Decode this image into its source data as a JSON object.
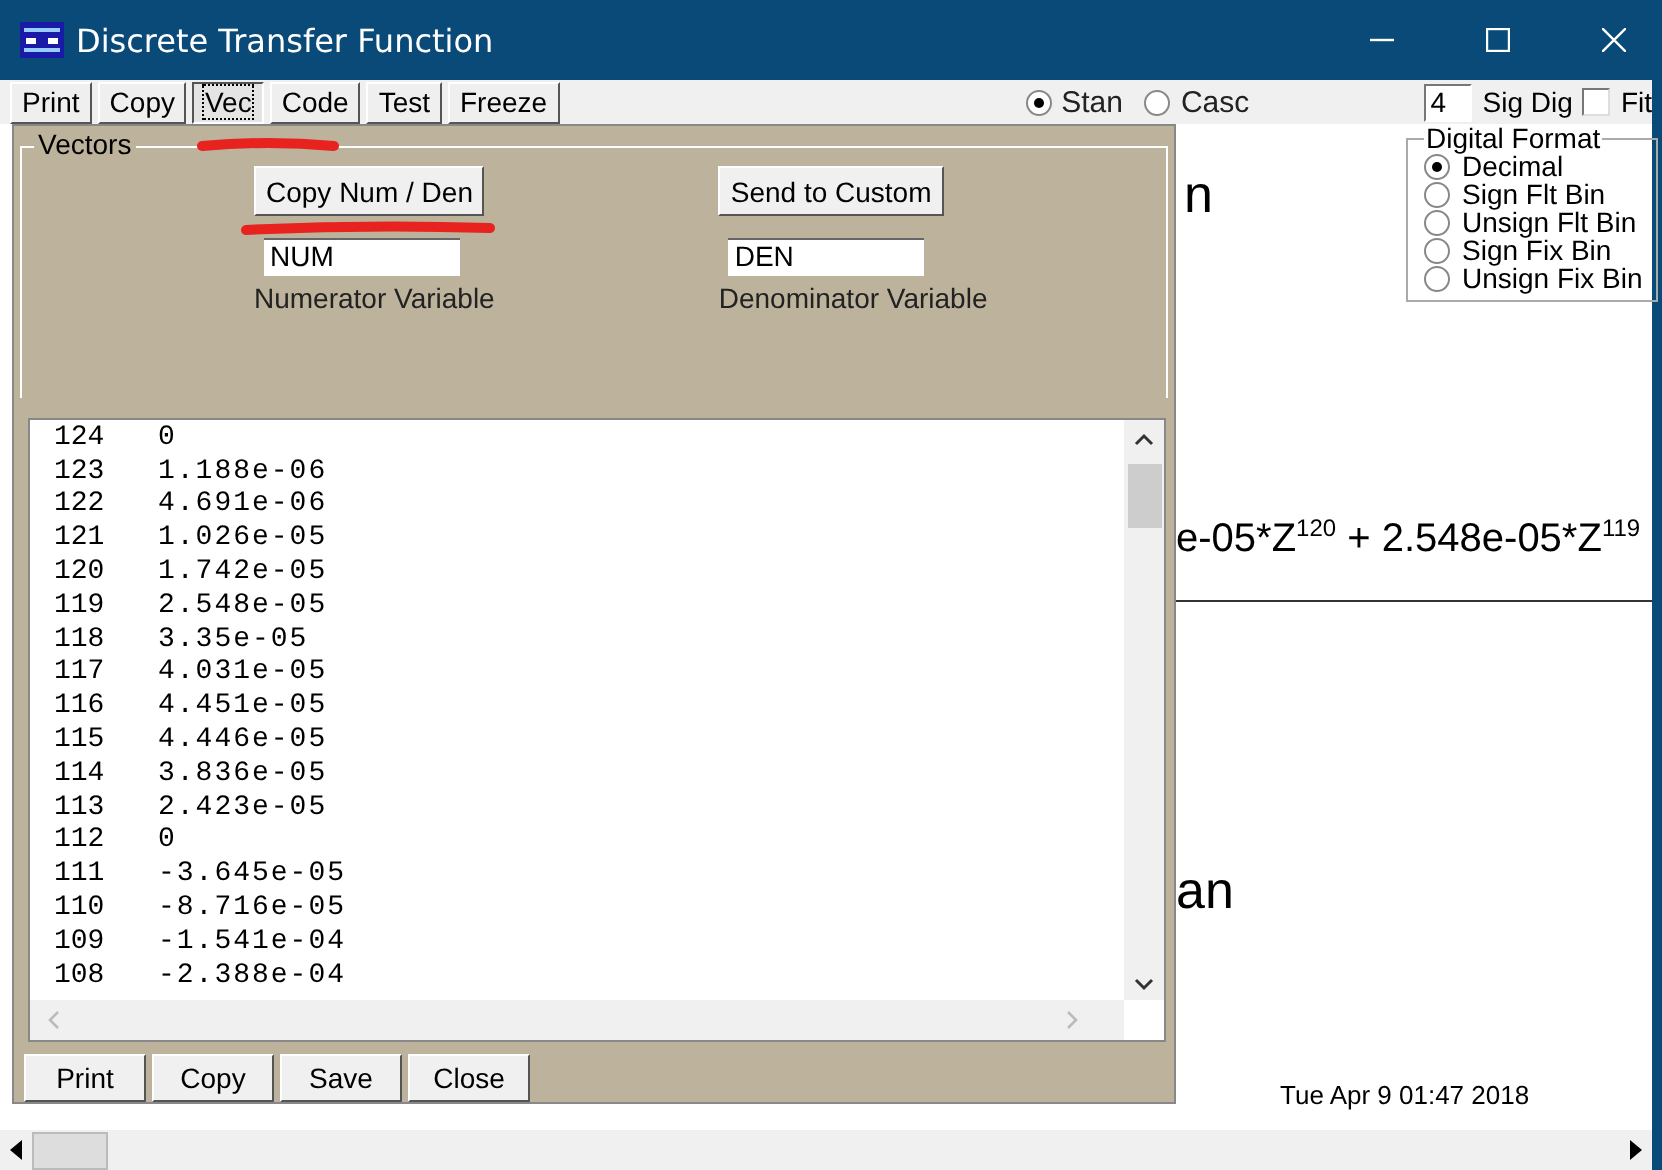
{
  "window": {
    "title": "Discrete Transfer Function"
  },
  "toolbar": {
    "buttons": [
      {
        "label": "Print",
        "selected": false
      },
      {
        "label": "Copy",
        "selected": false
      },
      {
        "label": "Vec",
        "selected": true
      },
      {
        "label": "Code",
        "selected": false
      },
      {
        "label": "Test",
        "selected": false
      },
      {
        "label": "Freeze",
        "selected": false
      }
    ],
    "form_radios": [
      {
        "label": "Stan",
        "selected": true
      },
      {
        "label": "Casc",
        "selected": false
      }
    ],
    "sig_dig": {
      "value": "4",
      "label": "Sig Dig"
    },
    "fit": {
      "label": "Fit",
      "checked": false
    }
  },
  "digital_format": {
    "title": "Digital Format",
    "options": [
      {
        "label": "Decimal",
        "selected": true
      },
      {
        "label": "Sign Flt Bin",
        "selected": false
      },
      {
        "label": "Unsign Flt Bin",
        "selected": false
      },
      {
        "label": "Sign Fix Bin",
        "selected": false
      },
      {
        "label": "Unsign Fix Bin",
        "selected": false
      }
    ]
  },
  "canvas": {
    "top_fragment": "n",
    "numerator": "e-05*Z$^{120}$ + 2.548e-05*Z$^{119}$",
    "bottom_fragment": "an",
    "timestamp": "Tue Apr 9 01:47 2018"
  },
  "dialog": {
    "title": "Vectors",
    "copy_button": "Copy Num / Den",
    "send_button": "Send to Custom",
    "numerator": {
      "value": "NUM",
      "label": "Numerator Variable"
    },
    "denominator": {
      "value": "DEN",
      "label": "Denominator Variable"
    },
    "rows": [
      {
        "index": "124",
        "value": "0"
      },
      {
        "index": "123",
        "value": "1.188e-06"
      },
      {
        "index": "122",
        "value": "4.691e-06"
      },
      {
        "index": "121",
        "value": "1.026e-05"
      },
      {
        "index": "120",
        "value": "1.742e-05"
      },
      {
        "index": "119",
        "value": "2.548e-05"
      },
      {
        "index": "118",
        "value": "3.35e-05"
      },
      {
        "index": "117",
        "value": "4.031e-05"
      },
      {
        "index": "116",
        "value": "4.451e-05"
      },
      {
        "index": "115",
        "value": "4.446e-05"
      },
      {
        "index": "114",
        "value": "3.836e-05"
      },
      {
        "index": "113",
        "value": "2.423e-05"
      },
      {
        "index": "112",
        "value": "0"
      },
      {
        "index": "111",
        "value": "-3.645e-05"
      },
      {
        "index": "110",
        "value": "-8.716e-05"
      },
      {
        "index": "109",
        "value": "-1.541e-04"
      },
      {
        "index": "108",
        "value": "-2.388e-04"
      }
    ],
    "buttons": [
      "Print",
      "Copy",
      "Save",
      "Close"
    ]
  }
}
